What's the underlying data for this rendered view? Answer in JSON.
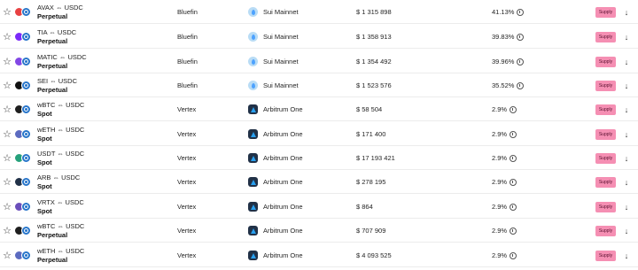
{
  "star_glyph": "☆",
  "arrow_glyph": "↓",
  "supply_label": "Supply",
  "colors": {
    "supply_button": "#f58fb3",
    "usdc": "#2775ca"
  },
  "rows": [
    {
      "pair": "AVAX ⇔ USDC",
      "kind": "Perpetual",
      "provider": "Bluefin",
      "network": "Sui Mainnet",
      "network_icon": "sui-icon",
      "tvl": "$ 1 315 898",
      "apy": "41.13%",
      "token_icon": "avax-icon",
      "token_color": "#e84142"
    },
    {
      "pair": "TIA ⇔ USDC",
      "kind": "Perpetual",
      "provider": "Bluefin",
      "network": "Sui Mainnet",
      "network_icon": "sui-icon",
      "tvl": "$ 1 358 913",
      "apy": "39.83%",
      "token_icon": "tia-icon",
      "token_color": "#7b2bf9"
    },
    {
      "pair": "MATIC ⇔ USDC",
      "kind": "Perpetual",
      "provider": "Bluefin",
      "network": "Sui Mainnet",
      "network_icon": "sui-icon",
      "tvl": "$ 1 354 492",
      "apy": "39.96%",
      "token_icon": "matic-icon",
      "token_color": "#8247e5"
    },
    {
      "pair": "SEI ⇔ USDC",
      "kind": "Perpetual",
      "provider": "Bluefin",
      "network": "Sui Mainnet",
      "network_icon": "sui-icon",
      "tvl": "$ 1 523 576",
      "apy": "35.52%",
      "token_icon": "sei-icon",
      "token_color": "#111111"
    },
    {
      "pair": "wBTC ⇔ USDC",
      "kind": "Spot",
      "provider": "Vertex",
      "network": "Arbitrum One",
      "network_icon": "arbitrum-icon",
      "tvl": "$ 58 504",
      "apy": "2.9%",
      "token_icon": "wbtc-icon",
      "token_color": "#1f1f1f"
    },
    {
      "pair": "wETH ⇔ USDC",
      "kind": "Spot",
      "provider": "Vertex",
      "network": "Arbitrum One",
      "network_icon": "arbitrum-icon",
      "tvl": "$ 171 400",
      "apy": "2.9%",
      "token_icon": "weth-icon",
      "token_color": "#5c6bc0"
    },
    {
      "pair": "USDT ⇔ USDC",
      "kind": "Spot",
      "provider": "Vertex",
      "network": "Arbitrum One",
      "network_icon": "arbitrum-icon",
      "tvl": "$ 17 193 421",
      "apy": "2.9%",
      "token_icon": "usdt-icon",
      "token_color": "#26a17b"
    },
    {
      "pair": "ARB ⇔ USDC",
      "kind": "Spot",
      "provider": "Vertex",
      "network": "Arbitrum One",
      "network_icon": "arbitrum-icon",
      "tvl": "$ 278 195",
      "apy": "2.9%",
      "token_icon": "arb-icon",
      "token_color": "#213147"
    },
    {
      "pair": "VRTX ⇔ USDC",
      "kind": "Spot",
      "provider": "Vertex",
      "network": "Arbitrum One",
      "network_icon": "arbitrum-icon",
      "tvl": "$ 864",
      "apy": "2.9%",
      "token_icon": "vrtx-icon",
      "token_color": "#6b4fbb"
    },
    {
      "pair": "wBTC ⇔ USDC",
      "kind": "Perpetual",
      "provider": "Vertex",
      "network": "Arbitrum One",
      "network_icon": "arbitrum-icon",
      "tvl": "$ 707 909",
      "apy": "2.9%",
      "token_icon": "wbtc-icon",
      "token_color": "#1f1f1f"
    },
    {
      "pair": "wETH ⇔ USDC",
      "kind": "Perpetual",
      "provider": "Vertex",
      "network": "Arbitrum One",
      "network_icon": "arbitrum-icon",
      "tvl": "$ 4 093 525",
      "apy": "2.9%",
      "token_icon": "weth-icon",
      "token_color": "#5c6bc0"
    }
  ]
}
